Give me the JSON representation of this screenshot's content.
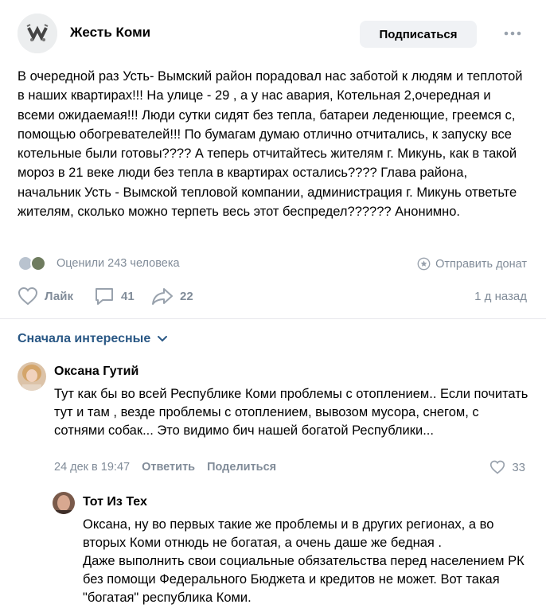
{
  "header": {
    "group_name": "Жесть Коми",
    "subscribe_label": "Подписаться"
  },
  "post": {
    "text": "В очередной раз Усть- Вымский район порадовал нас заботой к людям и теплотой в наших квартирах!!! На улице - 29 , а у нас авария, Котельная 2,очередная и всеми ожидаемая!!! Люди сутки сидят без тепла, батареи леденющие, греемся с, помощью обогревателей!!! По бумагам думаю отлично отчитались, к запуску все котельные были готовы???? А теперь отчитайтесь жителям г. Микунь, как в такой мороз в 21 веке люди без тепла в квартирах остались???? Глава района, начальник Усть - Вымской тепловой компании, администрация г. Микунь ответьте жителям, сколько можно терпеть весь этот беспредел?????? Анонимно.",
    "rated_text": "Оценили 243 человека",
    "donate_label": "Отправить донат",
    "like_label": "Лайк",
    "comments_count": "41",
    "shares_count": "22",
    "time_ago": "1 д назад"
  },
  "comments_sort": {
    "label": "Сначала интересные"
  },
  "comments": [
    {
      "author": "Оксана Гутий",
      "text": "Тут как бы во всей Республике Коми проблемы с отоплением.. Если почитать тут и там , везде проблемы с отоплением, вывозом мусора, снегом, с сотнями собак... Это видимо бич нашей богатой Республики...",
      "date": "24 дек в 19:47",
      "reply_label": "Ответить",
      "share_label": "Поделиться",
      "likes": "33"
    },
    {
      "author": "Тот Из Тех",
      "text_line1": "Оксана, ну во первых такие же проблемы и в других регионах, а во вторых Коми отнюдь не богатая, а очень даше же бедная .",
      "text_line2": "Даже выполнить свои социальные обязательства перед населением РК без помощи Федерального Бюджета и кредитов не может. Вот такая \"богатая\" республика Коми."
    }
  ],
  "colors": {
    "accent": "#2a5885",
    "secondary_text": "#818c99",
    "button_bg": "#f0f2f5",
    "divider": "#e7e8ec"
  },
  "icons": [
    "group-avatar",
    "more-dots-icon",
    "donate-star-icon",
    "heart-icon",
    "comment-icon",
    "share-arrow-icon",
    "chevron-down-icon"
  ]
}
